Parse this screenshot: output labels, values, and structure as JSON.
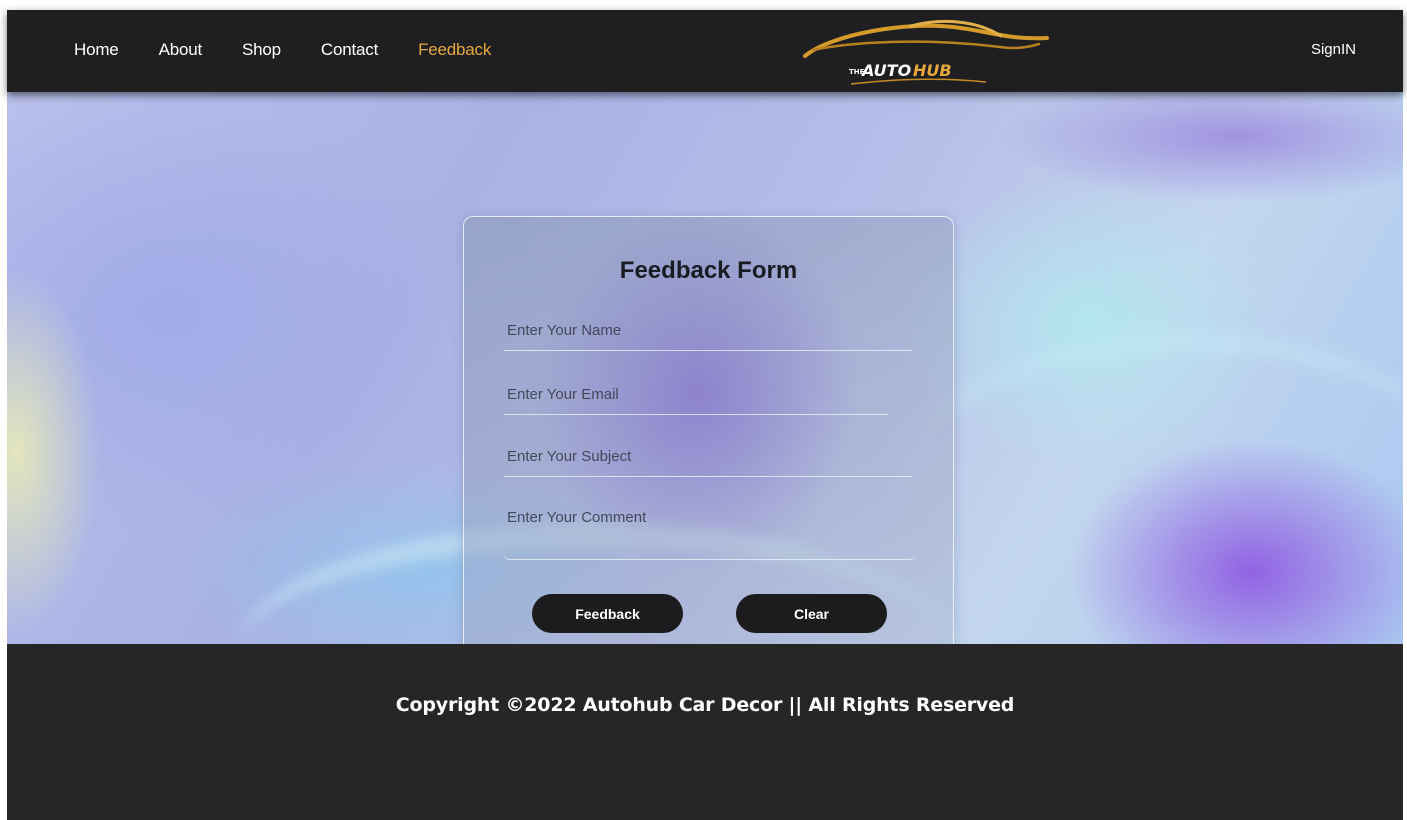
{
  "nav": {
    "links": [
      {
        "label": "Home"
      },
      {
        "label": "About"
      },
      {
        "label": "Shop"
      },
      {
        "label": "Contact"
      },
      {
        "label": "Feedback",
        "active": true
      }
    ],
    "signin_label": "SignIN"
  },
  "logo": {
    "the": "THE",
    "auto": "AUTO",
    "hub": "HUB"
  },
  "form": {
    "title": "Feedback Form",
    "name_placeholder": "Enter Your Name",
    "email_placeholder": "Enter Your Email",
    "subject_placeholder": "Enter Your Subject",
    "comment_placeholder": "Enter Your Comment",
    "submit_label": "Feedback",
    "clear_label": "Clear"
  },
  "footer": {
    "copyright": "Copyright ©2022 Autohub Car Decor || All Rights Reserved"
  },
  "colors": {
    "accent": "#e6a93c",
    "nav_bg": "#1f1f22",
    "footer_bg": "#262626",
    "button_bg": "#1c1c1e"
  }
}
